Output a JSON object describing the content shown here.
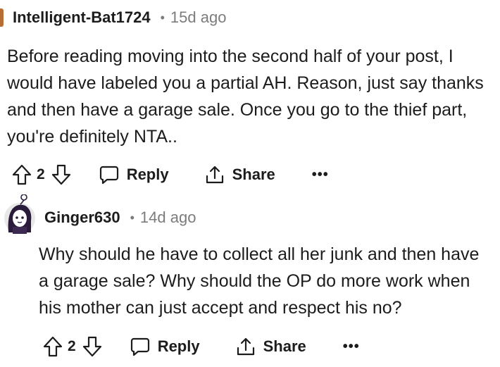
{
  "comments": [
    {
      "username": "Intelligent-Bat1724",
      "separator": "•",
      "time": "15d ago",
      "body": "Before reading moving into the second half of your post, I would have labeled you a partial AH. Reason, just say thanks and then have a garage sale. Once you go to the thief part, you're definitely NTA..",
      "votes": "2",
      "reply_label": "Reply",
      "share_label": "Share",
      "more_label": "•••"
    },
    {
      "username": "Ginger630",
      "separator": "•",
      "time": "14d ago",
      "body": "Why should he have to collect all her junk and then have a garage sale? Why should the OP do more work when his mother can just accept and respect his no?",
      "votes": "2",
      "reply_label": "Reply",
      "share_label": "Share",
      "more_label": "•••"
    }
  ],
  "icons": {
    "upvote": "arrow-up-outline-icon",
    "downvote": "arrow-down-outline-icon",
    "reply": "speech-bubble-icon",
    "share": "share-upload-icon",
    "more": "ellipsis-icon"
  },
  "colors": {
    "text": "#1c1c1c",
    "meta": "#7c7c7c",
    "avatar_left": "#b76e35",
    "avatar_hair": "#2b1b3a",
    "avatar_bg": "#e8e8e8"
  }
}
